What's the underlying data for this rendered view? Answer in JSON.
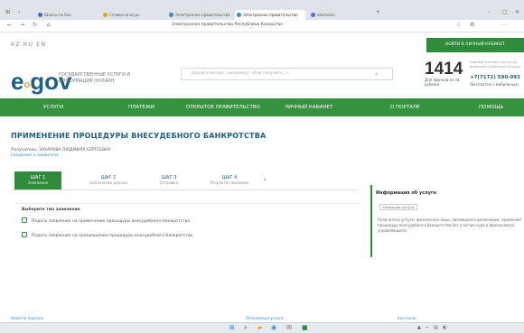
{
  "browser": {
    "tabs": [
      {
        "label": "Шансы на бан",
        "color": "#3a6fc4"
      },
      {
        "label": "Ставки на игры",
        "color": "#f0a020"
      },
      {
        "label": "Электронное правительство",
        "color": "#3a8dc2"
      },
      {
        "label": "Электронное правительство",
        "color": "#3a8dc2"
      },
      {
        "label": "electronic",
        "color": "#5a6fd0"
      }
    ],
    "address": "Электронное правительство Республики Казахстан"
  },
  "header": {
    "languages": "KZ  RU  EN",
    "login_button": "ВОЙТИ В ЛИЧНЫЙ КАБИНЕТ",
    "logo_main": "e",
    "logo_sub": "gov",
    "logo_mid": "o",
    "tagline": "ГОСУДАРСТВЕННЫЕ УСЛУГИ И ИНФОРМАЦИЯ ОНЛАЙН",
    "search_placeholder": "Задайте вопрос, например: «Как получить...»",
    "phone": "1414",
    "phone_note": "Единый контакт-центр по вопросам оказания госуслуг",
    "phone2": "+7(7172) 590-993",
    "phone2b": "(Бесплатно с мобильных)",
    "contact_center": "Для звонков из-за рубежа"
  },
  "nav": [
    "УСЛУГИ",
    "ПЛАТЕЖИ",
    "ОТКРЫТОЕ ПРАВИТЕЛЬСТВО",
    "ЛИЧНЫЙ КАБИНЕТ",
    "О ПОРТАЛЕ",
    "ПОМОЩЬ"
  ],
  "page": {
    "title": "ПРИМЕНЕНИЕ ПРОЦЕДУРЫ ВНЕСУДЕБНОГО БАНКРОТСТВА",
    "recipient_label": "Получатель: ЗАХАРОВА ЛЮДМИЛА СЕРГЕЕВНА",
    "recipient_sub": "Сведения о заявителе"
  },
  "steps": [
    {
      "name": "ШАГ 1",
      "desc": "Заявление"
    },
    {
      "name": "ШАГ 2",
      "desc": "Заполнение данных"
    },
    {
      "name": "ШАГ 3",
      "desc": "Отправка"
    },
    {
      "name": "ШАГ 4",
      "desc": "Результат оказания"
    }
  ],
  "form": {
    "heading": "Выберите тип заявления",
    "options": [
      "Подать заявление на применение процедуры внесудебного банкротства",
      "Подать заявление на прекращение процедуры внесудебного банкротства"
    ]
  },
  "info": {
    "heading": "Информация об услуге",
    "tag": "Описание услуги",
    "text": "Получатель услуги: физическое лицо, являющееся должником, применяет процедуру внесудебного банкротства без участия суда и финансового управляющего."
  },
  "footer": {
    "links": [
      "Новости портала",
      "Популярные услуги",
      "Контакты"
    ]
  },
  "colors": {
    "brand_green": "#2f8c3a",
    "brand_blue": "#1e5f86",
    "accent_orange": "#f0a020"
  }
}
